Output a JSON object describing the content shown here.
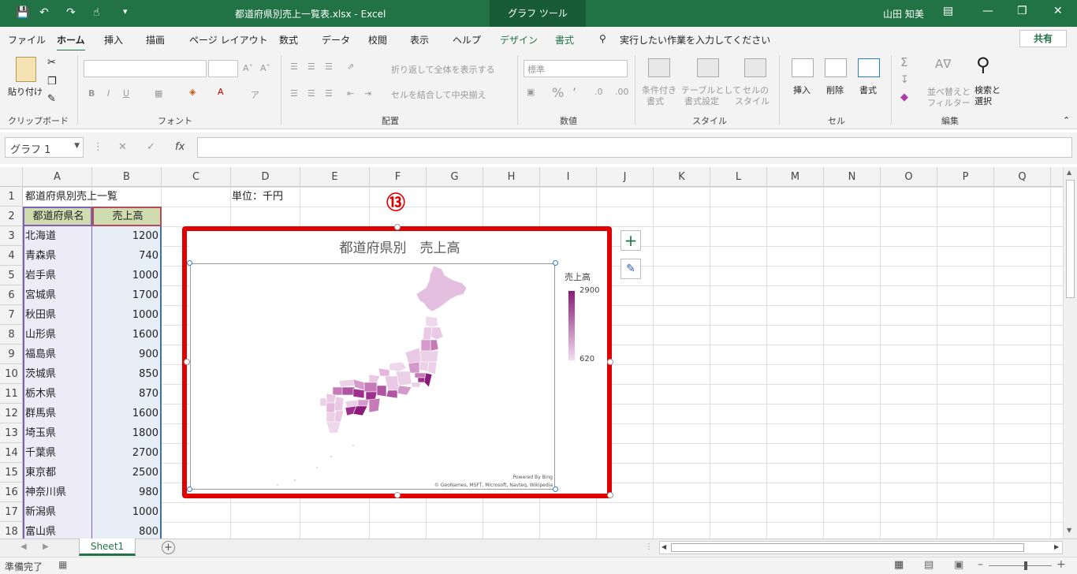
{
  "titlebar": {
    "file_title": "都道府県別売上一覧表.xlsx  -  Excel",
    "tool_tab": "グラフ ツール",
    "user": "山田 知美"
  },
  "ribbon_tabs": [
    "ファイル",
    "ホーム",
    "挿入",
    "描画",
    "ページ レイアウト",
    "数式",
    "データ",
    "校閲",
    "表示",
    "ヘルプ",
    "デザイン",
    "書式"
  ],
  "tell_me": "実行したい作業を入力してください",
  "share": "共有",
  "ribbon": {
    "paste": "貼り付け",
    "clipboard": "クリップボード",
    "font": "フォント",
    "alignment": "配置",
    "number": "数値",
    "styles": "スタイル",
    "cells": "セル",
    "editing": "編集",
    "wrap_text": "折り返して全体を表示する",
    "merge_center": "セルを結合して中央揃え",
    "number_format": "標準",
    "cond_format_1": "条件付き",
    "cond_format_2": "書式",
    "format_table_1": "テーブルとして",
    "format_table_2": "書式設定",
    "cell_style_1": "セルの",
    "cell_style_2": "スタイル",
    "insert": "挿入",
    "delete": "削除",
    "format": "書式",
    "sort_1": "並べ替えと",
    "sort_2": "フィルター",
    "find_1": "検索と",
    "find_2": "選択"
  },
  "namebox": "グラフ 1",
  "columns": [
    "A",
    "B",
    "C",
    "D",
    "E",
    "F",
    "G",
    "H",
    "I",
    "J",
    "K",
    "L",
    "M",
    "N",
    "O",
    "P",
    "Q"
  ],
  "rows": [
    "1",
    "2",
    "3",
    "4",
    "5",
    "6",
    "7",
    "8",
    "9",
    "10",
    "11",
    "12",
    "13",
    "14",
    "15",
    "16",
    "17",
    "18"
  ],
  "sheet": {
    "a1": "都道府県別売上一覧",
    "d1": "単位：千円",
    "header_name": "都道府県名",
    "header_value": "売上高",
    "data": [
      {
        "name": "北海道",
        "value": "1200"
      },
      {
        "name": "青森県",
        "value": "740"
      },
      {
        "name": "岩手県",
        "value": "1000"
      },
      {
        "name": "宮城県",
        "value": "1700"
      },
      {
        "name": "秋田県",
        "value": "1000"
      },
      {
        "name": "山形県",
        "value": "1600"
      },
      {
        "name": "福島県",
        "value": "900"
      },
      {
        "name": "茨城県",
        "value": "850"
      },
      {
        "name": "栃木県",
        "value": "870"
      },
      {
        "name": "群馬県",
        "value": "1600"
      },
      {
        "name": "埼玉県",
        "value": "1800"
      },
      {
        "name": "千葉県",
        "value": "2700"
      },
      {
        "name": "東京都",
        "value": "2500"
      },
      {
        "name": "神奈川県",
        "value": "980"
      },
      {
        "name": "新潟県",
        "value": "1000"
      },
      {
        "name": "富山県",
        "value": "800"
      }
    ]
  },
  "annotation": "⑬",
  "chart": {
    "title": "都道府県別　売上高",
    "legend_title": "売上高",
    "legend_max": "2900",
    "legend_min": "620",
    "credit_1": "Powered By Bing",
    "credit_2": "© GeoNames, MSFT, Microsoft, Navteq, Wikipedia",
    "color_high": "#8b1a7a",
    "color_low": "#f1dcef"
  },
  "sheet_tab": "Sheet1",
  "status": "準備完了",
  "colors": {
    "excel_green": "#217346",
    "highlight": "#e00000"
  }
}
